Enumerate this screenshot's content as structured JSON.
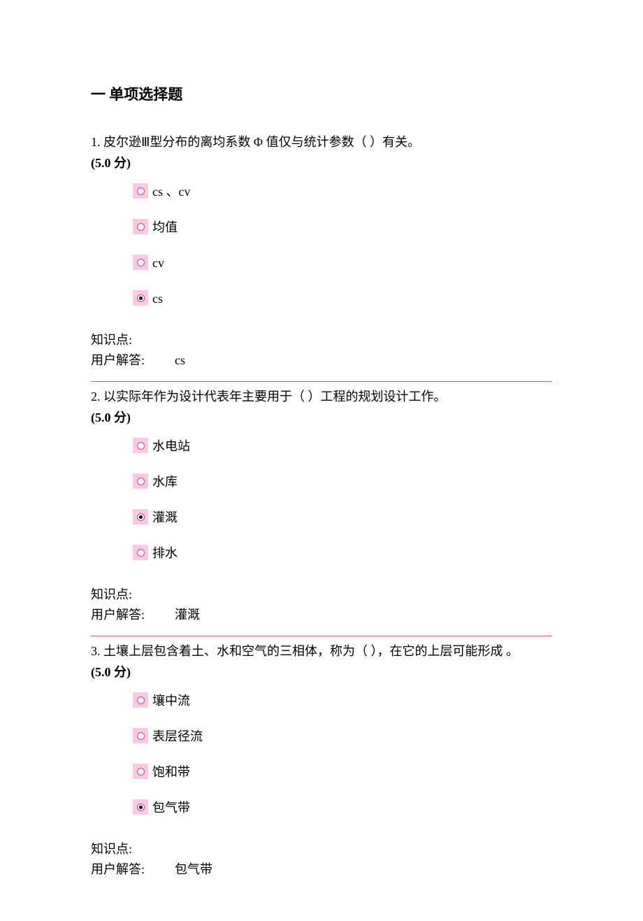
{
  "section_title": "一 单项选择题",
  "knowledge_label": "知识点:",
  "answer_label": "用户解答:",
  "questions": [
    {
      "number": "1.",
      "stem": "皮尔逊Ⅲ型分布的离均系数 Φ 值仅与统计参数（ ）有关。",
      "points": "(5.0 分)",
      "options": [
        {
          "label": "cs 、cv",
          "selected": false
        },
        {
          "label": "均值",
          "selected": false
        },
        {
          "label": "cv",
          "selected": false
        },
        {
          "label": "cs",
          "selected": true
        }
      ],
      "knowledge": "",
      "user_answer": "cs"
    },
    {
      "number": "2.",
      "stem": "以实际年作为设计代表年主要用于（ ）工程的规划设计工作。",
      "points": "(5.0 分)",
      "options": [
        {
          "label": "水电站",
          "selected": false
        },
        {
          "label": "水库",
          "selected": false
        },
        {
          "label": "灌溉",
          "selected": true
        },
        {
          "label": "排水",
          "selected": false
        }
      ],
      "knowledge": "",
      "user_answer": "灌溉"
    },
    {
      "number": "3.",
      "stem": "土壤上层包含着土、水和空气的三相体，称为（ ），在它的上层可能形成 。",
      "points": "(5.0 分)",
      "options": [
        {
          "label": "壤中流",
          "selected": false
        },
        {
          "label": "表层径流",
          "selected": false
        },
        {
          "label": "饱和带",
          "selected": false
        },
        {
          "label": "包气带",
          "selected": true
        }
      ],
      "knowledge": "",
      "user_answer": "包气带"
    }
  ]
}
